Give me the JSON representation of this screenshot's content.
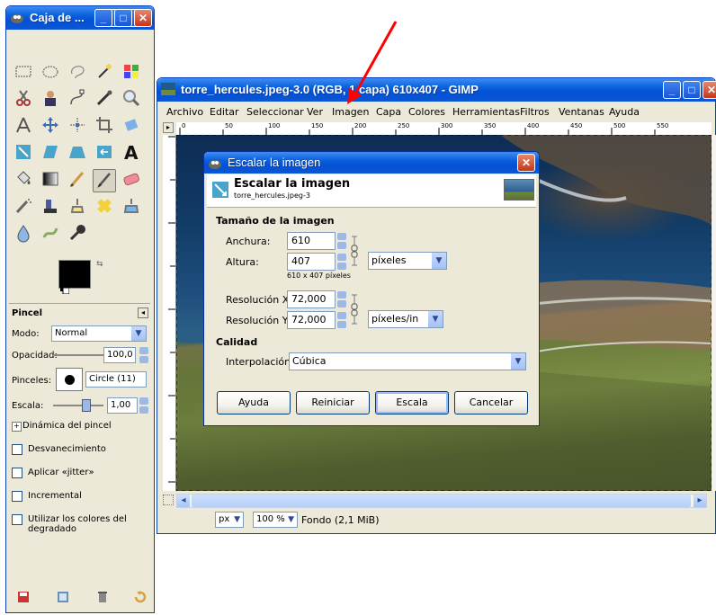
{
  "toolbox": {
    "title": "Caja de ...",
    "options_title": "Pincel",
    "mode_label": "Modo:",
    "mode_value": "Normal",
    "opacity_label": "Opacidad:",
    "opacity_value": "100,0",
    "brushes_label": "Pinceles:",
    "brush_value": "Circle (11)",
    "scale_label": "Escala:",
    "scale_value": "1,00",
    "dynamics_label": "Dinámica del pincel",
    "check_fade": "Desvanecimiento",
    "check_jitter": "Aplicar «jitter»",
    "check_incremental": "Incremental",
    "check_gradient": "Utilizar los colores del degradado"
  },
  "image_window": {
    "title": "torre_hercules.jpeg-3.0 (RGB, 1 capa) 610x407 - GIMP",
    "menu": [
      "Archivo",
      "Editar",
      "Seleccionar",
      "Ver",
      "Imagen",
      "Capa",
      "Colores",
      "Herramientas",
      "Filtros",
      "Ventanas",
      "Ayuda"
    ],
    "ruler_ticks": [
      "0",
      "50",
      "100",
      "150",
      "200",
      "250",
      "300",
      "350",
      "400",
      "450",
      "500",
      "550"
    ],
    "units": "px",
    "zoom": "100 %",
    "status": "Fondo (2,1 MiB)"
  },
  "dialog": {
    "title": "Escalar la imagen",
    "header_title": "Escalar la imagen",
    "header_subtitle": "torre_hercules.jpeg-3",
    "size_section": "Tamaño de la imagen",
    "width_label": "Anchura:",
    "width_value": "610",
    "height_label": "Altura:",
    "height_value": "407",
    "size_unit": "píxeles",
    "size_note": "610 x 407 píxeles",
    "res_x_label": "Resolución X:",
    "res_x_value": "72,000",
    "res_y_label": "Resolución Y:",
    "res_y_value": "72,000",
    "res_unit": "píxeles/in",
    "quality_section": "Calidad",
    "interp_label": "Interpolación:",
    "interp_value": "Cúbica",
    "btn_help": "Ayuda",
    "btn_reset": "Reiniciar",
    "btn_scale": "Escala",
    "btn_cancel": "Cancelar"
  },
  "colors": {
    "xp_title": "#0a5fdc",
    "window_bg": "#ece9d8",
    "arrow": "#ff0000"
  }
}
